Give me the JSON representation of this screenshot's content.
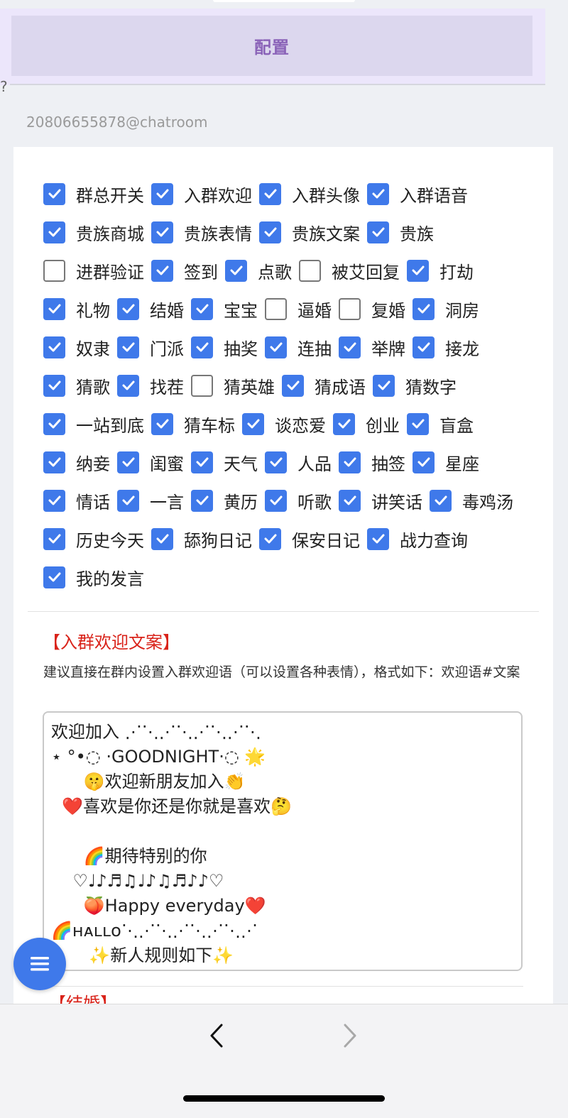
{
  "header": {
    "title": "配置"
  },
  "room_id": "20806655878@chatroom",
  "options": [
    {
      "label": "群总开关",
      "checked": true
    },
    {
      "label": "入群欢迎",
      "checked": true
    },
    {
      "label": "入群头像",
      "checked": true
    },
    {
      "label": "入群语音",
      "checked": true
    },
    {
      "label": "贵族商城",
      "checked": true
    },
    {
      "label": "贵族表情",
      "checked": true
    },
    {
      "label": "贵族文案",
      "checked": true
    },
    {
      "label": "贵族",
      "checked": true
    },
    {
      "label": "进群验证",
      "checked": false
    },
    {
      "label": "签到",
      "checked": true
    },
    {
      "label": "点歌",
      "checked": true
    },
    {
      "label": "被艾回复",
      "checked": false
    },
    {
      "label": "打劫",
      "checked": true
    },
    {
      "label": "礼物",
      "checked": true
    },
    {
      "label": "结婚",
      "checked": true
    },
    {
      "label": "宝宝",
      "checked": true
    },
    {
      "label": "逼婚",
      "checked": false
    },
    {
      "label": "复婚",
      "checked": false
    },
    {
      "label": "洞房",
      "checked": true
    },
    {
      "label": "奴隶",
      "checked": true
    },
    {
      "label": "门派",
      "checked": true
    },
    {
      "label": "抽奖",
      "checked": true
    },
    {
      "label": "连抽",
      "checked": true
    },
    {
      "label": "举牌",
      "checked": true
    },
    {
      "label": "接龙",
      "checked": true
    },
    {
      "label": "猜歌",
      "checked": true
    },
    {
      "label": "找茬",
      "checked": true
    },
    {
      "label": "猜英雄",
      "checked": false
    },
    {
      "label": "猜成语",
      "checked": true
    },
    {
      "label": "猜数字",
      "checked": true
    },
    {
      "label": "一站到底",
      "checked": true
    },
    {
      "label": "猜车标",
      "checked": true
    },
    {
      "label": "谈恋爱",
      "checked": true
    },
    {
      "label": "创业",
      "checked": true
    },
    {
      "label": "盲盒",
      "checked": true
    },
    {
      "label": "纳妾",
      "checked": true
    },
    {
      "label": "闺蜜",
      "checked": true
    },
    {
      "label": "天气",
      "checked": true
    },
    {
      "label": "人品",
      "checked": true
    },
    {
      "label": "抽签",
      "checked": true
    },
    {
      "label": "星座",
      "checked": true
    },
    {
      "label": "情话",
      "checked": true
    },
    {
      "label": "一言",
      "checked": true
    },
    {
      "label": "黄历",
      "checked": true
    },
    {
      "label": "听歌",
      "checked": true
    },
    {
      "label": "讲笑话",
      "checked": true
    },
    {
      "label": "毒鸡汤",
      "checked": true
    },
    {
      "label": "历史今天",
      "checked": true
    },
    {
      "label": "舔狗日记",
      "checked": true
    },
    {
      "label": "保安日记",
      "checked": true
    },
    {
      "label": "战力查询",
      "checked": true
    },
    {
      "label": "我的发言",
      "checked": true
    }
  ],
  "welcome_section": {
    "title": "【入群欢迎文案】",
    "hint": "建议直接在群内设置入群欢迎语（可以设置各种表情），格式如下：欢迎语#文案",
    "text_lines": [
      "欢迎加入 ⋰⋱⋰⋱⋰⋱⋰⋱",
      "⋆ °•◌ ·GOODNIGHT·◌ 🌟",
      "      🤫欢迎新朋友加入👏",
      "  ❤️喜欢是你还是你就是喜欢🤔",
      "",
      "      🌈期待特别的你",
      "    ♡♩♪♬♫♩♪♫♬♪♪♡",
      "      🍑Happy everyday❤️",
      "🌈ʜᴀʟʟᴏ⋱⋰⋱⋰⋱⋰⋱⋰",
      "       ✨新人规则如下✨"
    ]
  },
  "next_section": {
    "title": "【结婚】"
  },
  "colors": {
    "accent": "#3f79ea",
    "section_title": "#d9231a",
    "header_title": "#8a63b8"
  },
  "icons": {
    "fab": "menu-icon",
    "back": "chevron-left-icon",
    "forward": "chevron-right-icon"
  }
}
